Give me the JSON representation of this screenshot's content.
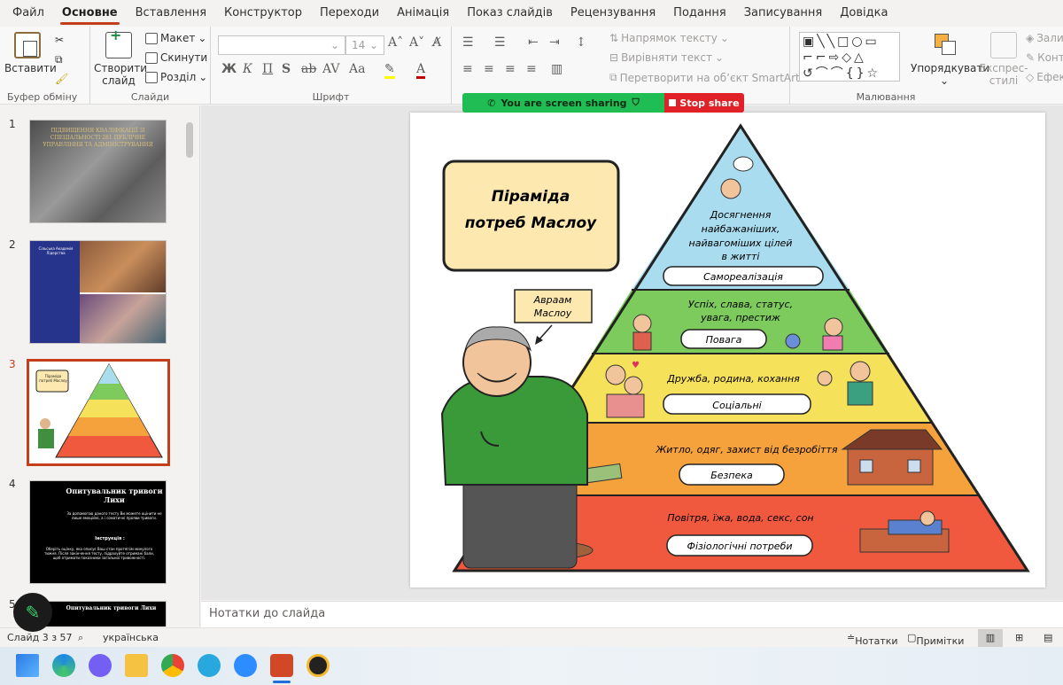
{
  "menu": [
    "Файл",
    "Основне",
    "Вставлення",
    "Конструктор",
    "Переходи",
    "Анімація",
    "Показ слайдів",
    "Рецензування",
    "Подання",
    "Записування",
    "Довідка"
  ],
  "ribbon": {
    "paste": "Вставити",
    "clipboard_group": "Буфер обміну",
    "new_slide_1": "Створити",
    "new_slide_2": "слайд",
    "layout": "Макет",
    "reset": "Скинути",
    "sections": "Розділ",
    "slides_group": "Слайди",
    "font_size": "14",
    "font_group": "Шрифт",
    "text_direction": "Напрямок тексту",
    "align_text": "Вирівняти текст",
    "smartart": "Перетворити на об’єкт SmartArt",
    "arrange": "Упорядкувати",
    "quick_styles_1": "Експрес-",
    "quick_styles_2": "стилі",
    "drawing_group": "Малювання",
    "shape_fill": "Залив",
    "shape_outline": "Конт",
    "shape_effects": "Ефек"
  },
  "share": {
    "sharing": "You are screen sharing",
    "stop": "Stop share"
  },
  "thumbnails": [
    {
      "num": "1",
      "text": "ПІДВИЩЕННЯ КВАЛІФІКАЦІЇ ЗІ СПЕЦІАЛЬНОСТІ 281 ПУБЛІЧНЕ УПРАВЛІННЯ ТА АДМІНІСТРУВАННЯ"
    },
    {
      "num": "2",
      "text": "Сільська Академія Лідерства"
    },
    {
      "num": "3",
      "text": "Піраміда потреб Маслоу"
    },
    {
      "num": "4",
      "title": "Опитувальник тривоги Лихи",
      "body": "За допомогою даного тесту Ви можете оцінити не лише емоційні, а і соматичні прояви тривоги.",
      "instr": "Інструкція :",
      "body2": "Оберіть оцінку, яка описує Ваш стан протягом минулого тижня. Після закінчення тесту, підрахуйте отримані бали, щоб отримати показники загальної тривожності."
    },
    {
      "num": "5",
      "title": "Опитувальник тривоги Лихи"
    }
  ],
  "slide": {
    "title_1": "Піраміда",
    "title_2": "потреб Маслоу",
    "author_1": "Авраам",
    "author_2": "Маслоу",
    "levels": [
      {
        "desc_1": "Досягнення",
        "desc_2": "найбажаніших,",
        "desc_3": "найвагоміших цілей",
        "desc_4": "в житті",
        "label": "Самореалізація",
        "color": "#a9dcee"
      },
      {
        "desc_1": "Успіх, слава, статус,",
        "desc_2": "увага, престиж",
        "label": "Повага",
        "color": "#7ccb5c"
      },
      {
        "desc_1": "Дружба, родина, кохання",
        "label": "Соціальні",
        "color": "#f6e15a"
      },
      {
        "desc_1": "Житло, одяг, захист від безробіття",
        "label": "Безпека",
        "color": "#f6a23c"
      },
      {
        "desc_1": "Повітря, їжа, вода, секс, сон",
        "label": "Фізіологічні потреби",
        "color": "#f1593f"
      }
    ]
  },
  "notes_placeholder": "Нотатки до слайда",
  "status": {
    "slide_of": "Слайд 3 з 57",
    "language": "українська",
    "notes": "Нотатки",
    "comments": "Примітки"
  }
}
